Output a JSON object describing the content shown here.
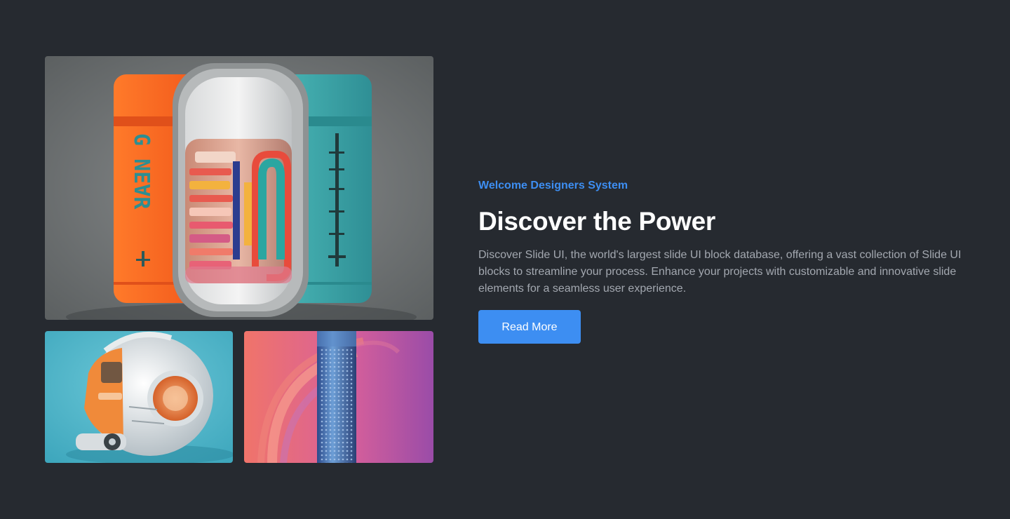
{
  "hero": {
    "eyebrow": "Welcome Designers System",
    "title": "Discover the Power",
    "description": "Discover Slide UI, the world's largest slide UI block database, offering a vast collection of Slide UI blocks to streamline your process. Enhance your projects with customizable and innovative slide elements for a seamless user experience.",
    "button_label": "Read More"
  },
  "gallery": {
    "images": [
      {
        "name": "capsule-devices-image"
      },
      {
        "name": "robot-image"
      },
      {
        "name": "speaker-image"
      }
    ]
  },
  "colors": {
    "background": "#262a30",
    "accent": "#3d8ef2",
    "heading": "#ffffff",
    "body_text": "#a3a8b0"
  }
}
